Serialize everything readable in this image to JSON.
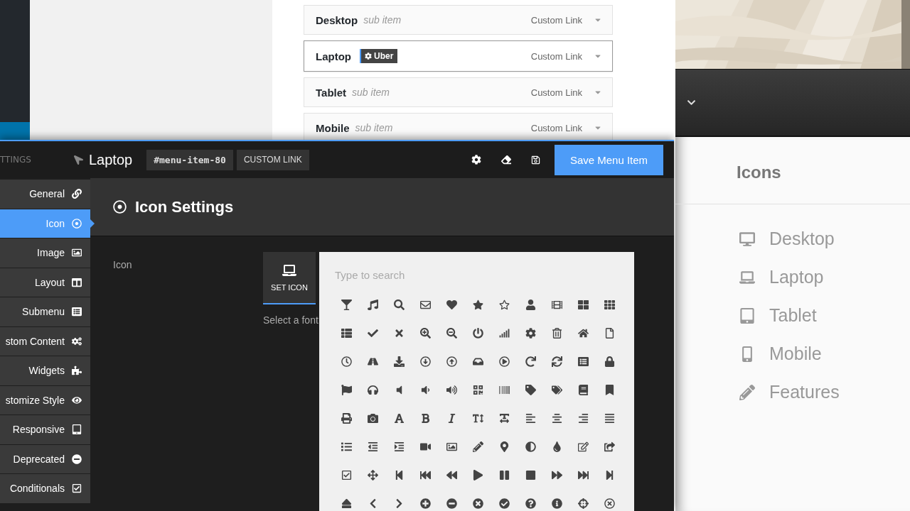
{
  "menu_items": [
    {
      "title": "Desktop",
      "note": "sub item",
      "type": "Custom Link",
      "selected": false
    },
    {
      "title": "Laptop",
      "badge": "Uber",
      "type": "Custom Link",
      "selected": true
    },
    {
      "title": "Tablet",
      "note": "sub item",
      "type": "Custom Link",
      "selected": false
    },
    {
      "title": "Mobile",
      "note": "sub item",
      "type": "Custom Link",
      "selected": false
    }
  ],
  "preview": {
    "heading": "Icons",
    "items": [
      {
        "label": "Desktop"
      },
      {
        "label": "Laptop"
      },
      {
        "label": "Tablet"
      },
      {
        "label": "Mobile"
      },
      {
        "label": "Features"
      }
    ]
  },
  "modal": {
    "section_label": "TTINGS",
    "title": "Laptop",
    "item_id": "#menu-item-80",
    "item_type": "CUSTOM LINK",
    "save_button": "Save Menu Item",
    "tabs": [
      {
        "label": "General",
        "selected": false
      },
      {
        "label": "Icon",
        "selected": true
      },
      {
        "label": "Image",
        "selected": false
      },
      {
        "label": "Layout",
        "selected": false
      },
      {
        "label": "Submenu",
        "selected": false
      },
      {
        "label": "stom Content",
        "selected": false
      },
      {
        "label": "Widgets",
        "selected": false
      },
      {
        "label": "stomize Style",
        "selected": false
      },
      {
        "label": "Responsive",
        "selected": false
      },
      {
        "label": "Deprecated",
        "selected": false
      },
      {
        "label": "Conditionals",
        "selected": false
      }
    ],
    "panel_title": "Icon Settings",
    "field_label": "Icon",
    "set_icon_button": "SET ICON",
    "hint": "Select a font",
    "search": {
      "placeholder": "Type to search"
    }
  }
}
